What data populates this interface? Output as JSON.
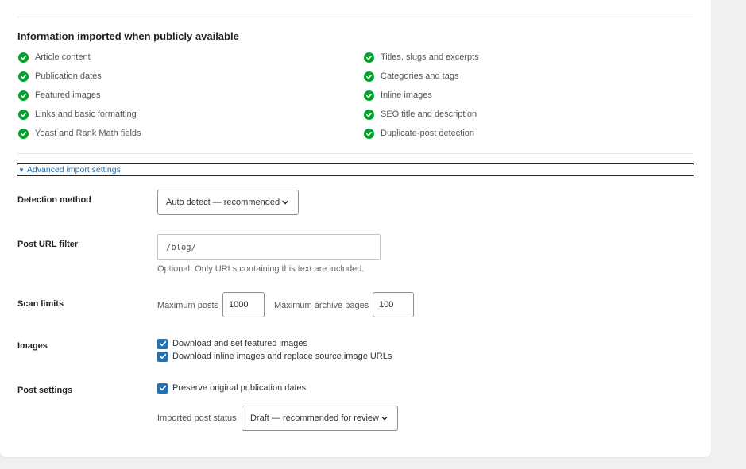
{
  "section": {
    "title": "Information imported when publicly available"
  },
  "features_left": [
    "Article content",
    "Publication dates",
    "Featured images",
    "Links and basic formatting",
    "Yoast and Rank Math fields"
  ],
  "features_right": [
    "Titles, slugs and excerpts",
    "Categories and tags",
    "Inline images",
    "SEO title and description",
    "Duplicate-post detection"
  ],
  "advanced": {
    "arrow": "▼",
    "label": "Advanced import settings"
  },
  "detection": {
    "label": "Detection method",
    "value": "Auto detect — recommended"
  },
  "url_filter": {
    "label": "Post URL filter",
    "value": "/blog/",
    "help": "Optional. Only URLs containing this text are included."
  },
  "scan_limits": {
    "label": "Scan limits",
    "max_posts_label": "Maximum posts",
    "max_posts_value": "1000",
    "max_archive_label": "Maximum archive pages",
    "max_archive_value": "100"
  },
  "images": {
    "label": "Images",
    "option1": "Download and set featured images",
    "option2": "Download inline images and replace source image URLs"
  },
  "post_settings": {
    "label": "Post settings",
    "preserve_dates": "Preserve original publication dates",
    "status_label": "Imported post status",
    "status_value": "Draft — recommended for review"
  },
  "colors": {
    "accent": "#2271b1",
    "success": "#00a32a",
    "background": "#f0f0f1"
  },
  "icons": {
    "check": "check-circle-icon",
    "checkbox": "checkbox-checked-icon",
    "chevron": "chevron-down-icon"
  }
}
